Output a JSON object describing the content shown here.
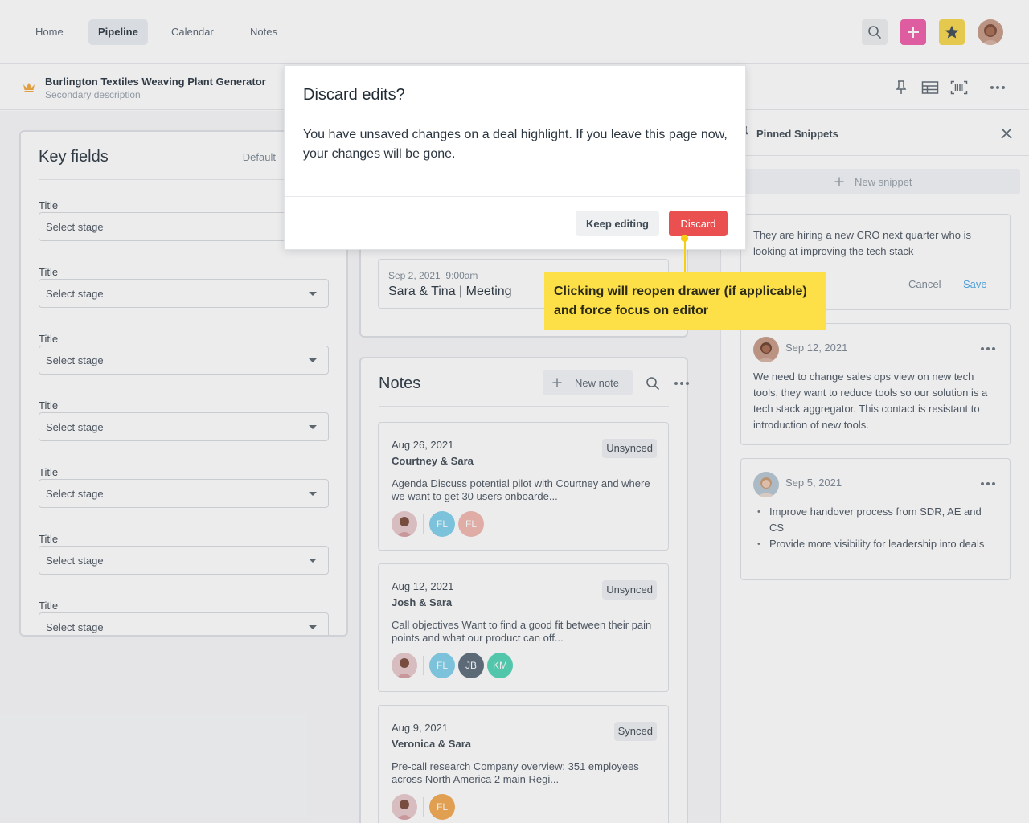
{
  "nav": {
    "tabs": [
      "Home",
      "Pipeline",
      "Calendar",
      "Notes"
    ],
    "active_tab": "Pipeline",
    "icons": [
      "search-icon",
      "plus-icon",
      "star-icon",
      "avatar"
    ],
    "colors": {
      "plus": "#f05ca8",
      "star": "#f8d84a"
    }
  },
  "deal": {
    "title": "Burlington Textiles Weaving Plant Generator",
    "subtitle": "Secondary description",
    "icons": [
      "crown-icon",
      "pin-icon",
      "table-icon",
      "barcode-icon",
      "more-icon"
    ]
  },
  "key_fields": {
    "title": "Key fields",
    "default_label": "Default",
    "fields": [
      {
        "label": "Title",
        "value": "Select stage"
      },
      {
        "label": "Title",
        "value": "Select stage"
      },
      {
        "label": "Title",
        "value": "Select stage"
      },
      {
        "label": "Title",
        "value": "Select stage"
      },
      {
        "label": "Title",
        "value": "Select stage"
      },
      {
        "label": "Title",
        "value": "Select stage"
      },
      {
        "label": "Title",
        "value": "Select stage"
      }
    ]
  },
  "meeting": {
    "date": "Sep 2, 2021",
    "time": "9:00am",
    "title": "Sara & Tina | Meeting"
  },
  "notes": {
    "title": "Notes",
    "new_note_label": "New note",
    "items": [
      {
        "date": "Aug 26, 2021",
        "names": "Courtney & Sara",
        "status": "Unsynced",
        "body": "Agenda Discuss potential pilot with Courtney and where we want to get 30 users onboarde...",
        "initials": [
          "FL",
          "FL"
        ]
      },
      {
        "date": "Aug 12, 2021",
        "names": "Josh & Sara",
        "status": "Unsynced",
        "body": "Call objectives Want to find a good fit between their pain points and what our product can off...",
        "initials": [
          "FL",
          "JB",
          "KM"
        ]
      },
      {
        "date": "Aug 9, 2021",
        "names": "Veronica & Sara",
        "status": "Synced",
        "body": "Pre-call research Company overview: 351 employees across North America 2 main Regi...",
        "initials": [
          "FL"
        ]
      }
    ]
  },
  "pinned": {
    "title": "Pinned Snippets",
    "new_snippet_label": "New snippet",
    "draft": {
      "text": "They are hiring a new CRO next quarter who is looking at improving the tech stack",
      "cancel_label": "Cancel",
      "save_label": "Save"
    },
    "snippets": [
      {
        "date": "Sep 12, 2021",
        "text": "We need to change sales ops view on new tech tools, they want to reduce tools so our solution is a tech stack aggregator. This contact is resistant to introduction of new tools."
      },
      {
        "date": "Sep 5, 2021",
        "bullets": [
          "Improve handover process from SDR, AE and CS",
          "Provide more visibility for leadership into deals"
        ]
      }
    ]
  },
  "modal": {
    "title": "Discard edits?",
    "body": "You have unsaved changes on a deal highlight. If you leave this page now, your changes will be gone.",
    "keep_label": "Keep editing",
    "discard_label": "Discard",
    "discard_color": "#e9504f"
  },
  "callout": {
    "text": "Clicking will reopen drawer (if applicable) and force focus on editor",
    "color": "#fde047"
  }
}
